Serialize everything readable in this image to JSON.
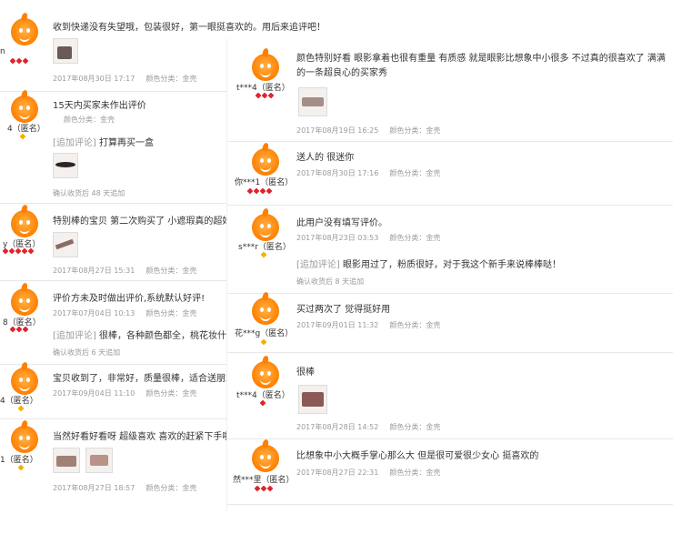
{
  "left": [
    {
      "user": "n",
      "badge_count": 3,
      "badge_color": "red",
      "text": "收到快递没有失望哦，包装很好，第一眼挺喜欢的。用后来追评吧！",
      "date": "2017年08月30日 17:17",
      "spec": "颜色分类：金壳"
    },
    {
      "user": "4（匿名）",
      "badge_count": 1,
      "badge_color": "gold",
      "text": "15天内买家未作出评价",
      "date": "",
      "spec": "颜色分类：金壳",
      "add_tag": "[追加评论]",
      "add_text": "打算再买一盒",
      "add_time": "确认收货后 48 天追加"
    },
    {
      "user": "y（匿名）",
      "badge_count": 5,
      "badge_color": "red",
      "text": "特别棒的宝贝 第二次购买了 小遮瑕真的超好用",
      "date": "2017年08月27日 15:31",
      "spec": "颜色分类：金壳"
    },
    {
      "user": "8（匿名）",
      "badge_count": 3,
      "badge_color": "red",
      "text": "评价方未及时做出评价,系统默认好评!",
      "date": "2017年07月04日 10:13",
      "spec": "颜色分类：金壳",
      "add_tag": "[追加评论]",
      "add_text": "很棒，各种颜色都全，桃花妆什么的",
      "add_time": "确认收货后 6 天追加"
    },
    {
      "user": "4（匿名）",
      "badge_count": 1,
      "badge_color": "gold",
      "text": "宝贝收到了，非常好，质量很棒，适合送朋友的",
      "date": "2017年09月04日 11:10",
      "spec": "颜色分类：金壳"
    },
    {
      "user": "1（匿名）",
      "badge_count": 1,
      "badge_color": "gold",
      "text": "当然好看好看呀 超级喜欢 喜欢的赶紧下手啦",
      "date": "2017年08月27日 18:57",
      "spec": "颜色分类：金壳"
    }
  ],
  "right": [
    {
      "user": "t***4（匿名）",
      "badge_count": 3,
      "badge_color": "red",
      "text": "颜色特别好看 眼影拿着也很有重量 有质感 就是眼影比想象中小很多 不过真的很喜欢了 满满的一条超良心的买家秀",
      "date": "2017年08月19日 16:25",
      "spec": "颜色分类：金壳"
    },
    {
      "user": "你***1（匿名）",
      "badge_count": 4,
      "badge_color": "red",
      "text": "送人的 很迷你",
      "date": "2017年08月30日 17:16",
      "spec": "颜色分类：金壳"
    },
    {
      "user": "s***r（匿名）",
      "badge_count": 1,
      "badge_color": "gold",
      "text": "此用户没有填写评价。",
      "date": "2017年08月23日 03:53",
      "spec": "颜色分类：金壳",
      "add_tag": "[追加评论]",
      "add_text": "眼影用过了，粉质很好，对于我这个新手来说棒棒哒！",
      "add_time": "确认收货后 8 天追加"
    },
    {
      "user": "花***g（匿名）",
      "badge_count": 1,
      "badge_color": "gold",
      "text": "买过两次了 觉得挺好用",
      "date": "2017年09月01日 11:32",
      "spec": "颜色分类：金壳"
    },
    {
      "user": "t***4（匿名）",
      "badge_count": 1,
      "badge_color": "red",
      "text": "很棒",
      "date": "2017年08月28日 14:52",
      "spec": "颜色分类：金壳"
    },
    {
      "user": "然***里（匿名）",
      "badge_count": 3,
      "badge_color": "red",
      "text": "比想象中小大概手掌心那么大 但是很可爱很少女心 挺喜欢的",
      "date": "2017年08月27日 22:31",
      "spec": "颜色分类：金壳"
    }
  ]
}
